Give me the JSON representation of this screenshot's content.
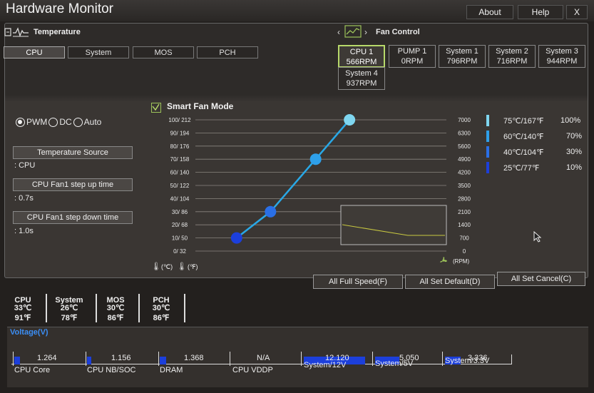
{
  "app": {
    "title": "Hardware Monitor"
  },
  "top_buttons": {
    "about": "About",
    "help": "Help",
    "close": "X"
  },
  "temperature": {
    "title": "Temperature",
    "tabs": [
      "CPU",
      "System",
      "MOS",
      "PCH"
    ],
    "active_tab": "CPU"
  },
  "fan_control": {
    "title": "Fan Control",
    "fans": [
      {
        "name": "CPU 1",
        "rpm": "566RPM"
      },
      {
        "name": "PUMP 1",
        "rpm": "0RPM"
      },
      {
        "name": "System 1",
        "rpm": "796RPM"
      },
      {
        "name": "System 2",
        "rpm": "716RPM"
      },
      {
        "name": "System 3",
        "rpm": "944RPM"
      },
      {
        "name": "System 4",
        "rpm": "937RPM"
      }
    ],
    "selected_fan": "CPU 1"
  },
  "mode": {
    "options": [
      "PWM",
      "DC",
      "Auto"
    ],
    "selected": "PWM"
  },
  "settings": {
    "temperature_source_label": "Temperature Source",
    "temperature_source_value": ": CPU",
    "step_up_label": "CPU Fan1 step up time",
    "step_up_value": ": 0.7s",
    "step_down_label": "CPU Fan1 step down time",
    "step_down_value": ": 1.0s"
  },
  "smart_fan": {
    "checkbox_label": "Smart Fan Mode",
    "checked": true,
    "unit_c": "(℃)",
    "unit_f": "(℉)",
    "rpm_label": "(RPM)"
  },
  "chart_data": {
    "type": "line",
    "title": "Smart Fan Mode",
    "y_left_ticks": [
      "100/ 212",
      "90/ 194",
      "80/ 176",
      "70/ 158",
      "60/ 140",
      "50/ 122",
      "40/ 104",
      "30/  86",
      "20/  68",
      "10/  50",
      "0/  32"
    ],
    "y_right_ticks": [
      "7000",
      "6300",
      "5600",
      "4900",
      "4200",
      "3500",
      "2800",
      "2100",
      "1400",
      "700",
      "0"
    ],
    "series": [
      {
        "x": [
          25,
          40,
          60,
          75
        ],
        "y": [
          10,
          30,
          70,
          100
        ],
        "color": "#29a8e6"
      }
    ],
    "curve_points": [
      {
        "temp_c": 25,
        "temp_f": 77,
        "percent": 10,
        "color": "#1c3fdb"
      },
      {
        "temp_c": 40,
        "temp_f": 104,
        "percent": 30,
        "color": "#2a6fe6"
      },
      {
        "temp_c": 60,
        "temp_f": 140,
        "percent": 70,
        "color": "#2ea0ea"
      },
      {
        "temp_c": 75,
        "temp_f": 167,
        "percent": 100,
        "color": "#7fd6f0"
      }
    ],
    "legend": [
      {
        "temp": "75℃/167℉",
        "percent": "100%",
        "color": "#7fd6f0"
      },
      {
        "temp": "60℃/140℉",
        "percent": "70%",
        "color": "#2ea0ea"
      },
      {
        "temp": "40℃/104℉",
        "percent": "30%",
        "color": "#2a6fe6"
      },
      {
        "temp": "25℃/77℉",
        "percent": "10%",
        "color": "#1c3fdb"
      }
    ],
    "ylim_percent": [
      0,
      100
    ],
    "ylim_rpm": [
      0,
      7000
    ],
    "grid": true
  },
  "actions": {
    "full_speed": "All Full Speed(F)",
    "set_default": "All Set Default(D)",
    "set_cancel": "All Set Cancel(C)"
  },
  "temps": [
    {
      "name": "CPU",
      "c": "33℃",
      "f": "91℉"
    },
    {
      "name": "System",
      "c": "26℃",
      "f": "78℉"
    },
    {
      "name": "MOS",
      "c": "30℃",
      "f": "86℉"
    },
    {
      "name": "PCH",
      "c": "30℃",
      "f": "86℉"
    }
  ],
  "voltage": {
    "title": "Voltage(V)",
    "items": [
      {
        "name": "CPU Core",
        "value": "1.264",
        "level": 0.08
      },
      {
        "name": "CPU NB/SOC",
        "value": "1.156",
        "level": 0.07
      },
      {
        "name": "DRAM",
        "value": "1.368",
        "level": 0.09
      },
      {
        "name": "CPU VDDP",
        "value": "N/A",
        "level": 0
      },
      {
        "name": "System/12V",
        "value": "12.120",
        "level": 0.95
      },
      {
        "name": "System/5V",
        "value": "5.050",
        "level": 0.4
      },
      {
        "name": "System/3.3V",
        "value": "3.336",
        "level": 0.26
      }
    ],
    "accent": "#1c3fdb"
  }
}
